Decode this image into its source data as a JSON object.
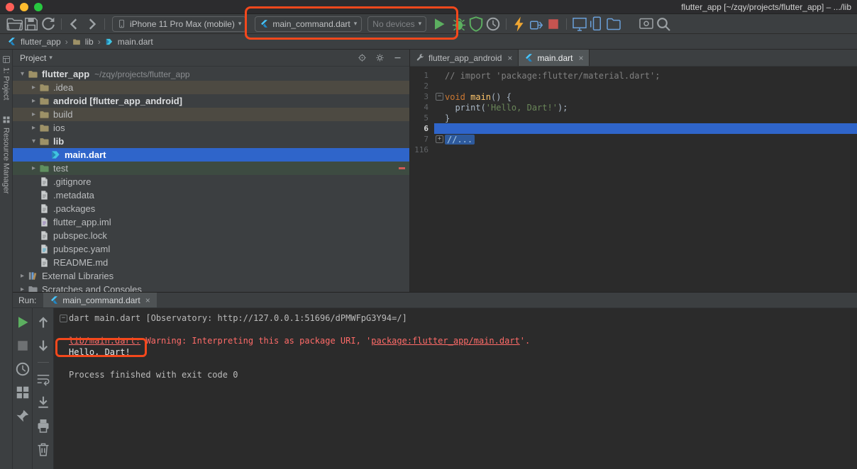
{
  "colors": {
    "annotation": "#f4481c",
    "selection": "#2f65ca",
    "error_red": "#ff6b68"
  },
  "titlebar": {
    "title": "flutter_app [~/zqy/projects/flutter_app] – .../lib"
  },
  "toolbar": {
    "left_actions": [
      "open-folder",
      "save",
      "sync"
    ],
    "nav_actions": [
      "back",
      "forward"
    ],
    "device_combo": {
      "value": "iPhone 11 Pro Max (mobile)"
    },
    "run_config_combo": {
      "value": "main_command.dart"
    },
    "target_combo": {
      "value": "No devices"
    },
    "run_action": "play",
    "right_actions": [
      "debug-bug",
      "coverage-shield",
      "profiler",
      "divider",
      "hot-reload-bolt",
      "attach-debugger",
      "stop",
      "divider",
      "layout-inspector",
      "device-manager",
      "device-file-explorer"
    ],
    "far_actions": [
      "screenshot",
      "search"
    ]
  },
  "breadcrumbs": {
    "items": [
      "flutter_app",
      "lib",
      "main.dart"
    ]
  },
  "stripe": {
    "buttons": [
      {
        "icon": "stripe-project",
        "label": "1: Project"
      },
      {
        "icon": "stripe-resource",
        "label": "Resource Manager"
      }
    ]
  },
  "project_panel": {
    "header": {
      "title": "Project",
      "actions": [
        "locate-target",
        "gear",
        "minimize"
      ]
    },
    "tree": [
      {
        "label": "flutter_app",
        "suffix": "~/zqy/projects/flutter_app",
        "icon": "folder",
        "arrow": "down",
        "bold": true,
        "indent": 0,
        "row": "plain"
      },
      {
        "label": ".idea",
        "icon": "folder",
        "arrow": "right",
        "indent": 1,
        "row": "olive"
      },
      {
        "label": "android [flutter_app_android]",
        "icon": "folder",
        "arrow": "right",
        "bold": true,
        "indent": 1,
        "row": "plain"
      },
      {
        "label": "build",
        "icon": "folder",
        "arrow": "right",
        "indent": 1,
        "row": "olive"
      },
      {
        "label": "ios",
        "icon": "folder",
        "arrow": "right",
        "indent": 1,
        "row": "plain"
      },
      {
        "label": "lib",
        "icon": "folder",
        "arrow": "down",
        "bold": true,
        "indent": 1,
        "row": "plain"
      },
      {
        "label": "main.dart",
        "icon": "dart",
        "arrow": "none",
        "bold": true,
        "indent": 2,
        "row": "selected"
      },
      {
        "label": "test",
        "icon": "folder-test",
        "arrow": "right",
        "indent": 1,
        "row": "green",
        "marker": true
      },
      {
        "label": ".gitignore",
        "icon": "file",
        "arrow": "none",
        "indent": 1,
        "row": "plain"
      },
      {
        "label": ".metadata",
        "icon": "file",
        "arrow": "none",
        "indent": 1,
        "row": "plain"
      },
      {
        "label": ".packages",
        "icon": "file",
        "arrow": "none",
        "indent": 1,
        "row": "plain"
      },
      {
        "label": "flutter_app.iml",
        "icon": "file-iml",
        "arrow": "none",
        "indent": 1,
        "row": "plain"
      },
      {
        "label": "pubspec.lock",
        "icon": "file",
        "arrow": "none",
        "indent": 1,
        "row": "plain"
      },
      {
        "label": "pubspec.yaml",
        "icon": "file-yaml",
        "arrow": "none",
        "indent": 1,
        "row": "plain"
      },
      {
        "label": "README.md",
        "icon": "file",
        "arrow": "none",
        "indent": 1,
        "row": "plain"
      },
      {
        "label": "External Libraries",
        "icon": "books",
        "arrow": "right",
        "indent": 0,
        "row": "plain"
      },
      {
        "label": "Scratches and Consoles",
        "icon": "scratch",
        "arrow": "right",
        "indent": 0,
        "row": "plain"
      }
    ]
  },
  "editor": {
    "tabs": [
      {
        "label": "flutter_app_android",
        "icon": "wrench",
        "active": false
      },
      {
        "label": "main.dart",
        "icon": "flutter",
        "active": true
      }
    ],
    "code_lines": [
      {
        "num": "1",
        "tokens": [
          {
            "t": "// import 'package:flutter/material.dart';",
            "c": "cmt"
          }
        ]
      },
      {
        "num": "2",
        "tokens": []
      },
      {
        "num": "3",
        "fold": "minus",
        "tokens": [
          {
            "t": "void ",
            "c": "kw"
          },
          {
            "t": "main",
            "c": "fn"
          },
          {
            "t": "() {",
            "c": "pln"
          }
        ]
      },
      {
        "num": "4",
        "tokens": [
          {
            "t": "  print(",
            "c": "pln"
          },
          {
            "t": "'Hello, Dart!'",
            "c": "str"
          },
          {
            "t": ");",
            "c": "pln"
          }
        ]
      },
      {
        "num": "5",
        "tokens": [
          {
            "t": "}",
            "c": "pln"
          }
        ]
      },
      {
        "num": "6",
        "selected": true,
        "tokens": []
      },
      {
        "num": "7",
        "fold": "plus",
        "tokens": [
          {
            "t": "//...",
            "c": "fold"
          }
        ]
      },
      {
        "num": "116",
        "tokens": []
      }
    ]
  },
  "run_panel": {
    "label": "Run:",
    "tab": {
      "label": "main_command.dart",
      "icon": "flutter"
    },
    "outer_toolbar": [
      "rerun",
      "stop-dim",
      "clock",
      "grid",
      "pin"
    ],
    "inner_toolbar": [
      "arrow-up",
      "arrow-down",
      "divider",
      "softwrap",
      "scroll-end",
      "print",
      "trash"
    ],
    "console_lines": [
      {
        "fold": true,
        "segs": [
          {
            "t": "dart main.dart [Observatory: http://127.0.0.1:51696/dPMWFpG3Y94=/]",
            "c": "pln"
          }
        ]
      },
      {
        "segs": []
      },
      {
        "segs": [
          {
            "t": "lib/main.dart:",
            "c": "err link"
          },
          {
            "t": " Warning: Interpreting this as package URI, '",
            "c": "err"
          },
          {
            "t": "package:flutter_app/main.dart",
            "c": "err link"
          },
          {
            "t": "'.",
            "c": "err"
          }
        ]
      },
      {
        "segs": [
          {
            "t": "Hello, Dart!",
            "c": "out"
          }
        ]
      },
      {
        "segs": []
      },
      {
        "segs": [
          {
            "t": "Process finished with exit code 0",
            "c": "pln"
          }
        ]
      }
    ]
  }
}
